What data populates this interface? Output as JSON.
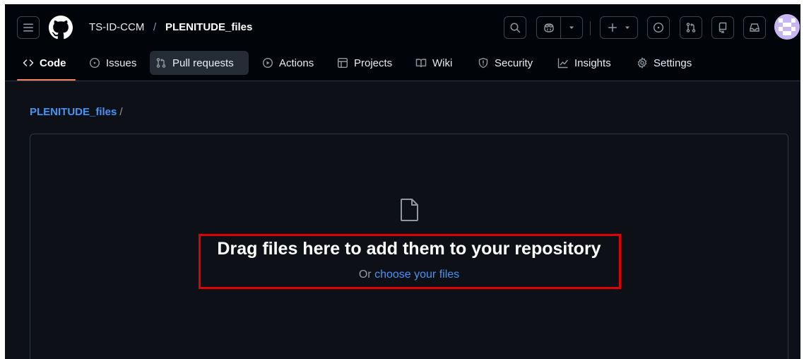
{
  "header": {
    "owner": "TS-ID-CCM",
    "separator": "/",
    "repo_name": "PLENITUDE_files",
    "icons": [
      "menu-icon",
      "github-logo",
      "search-icon",
      "copilot-icon",
      "chevron-down-icon",
      "plus-icon",
      "issue-opened-icon",
      "git-pull-request-icon",
      "repo-icon",
      "inbox-icon",
      "avatar"
    ]
  },
  "tabs": [
    {
      "label": "Code",
      "icon": "code-icon",
      "active": true
    },
    {
      "label": "Issues",
      "icon": "issue-opened-icon"
    },
    {
      "label": "Pull requests",
      "icon": "git-pull-request-icon"
    },
    {
      "label": "Actions",
      "icon": "play-icon"
    },
    {
      "label": "Projects",
      "icon": "table-icon"
    },
    {
      "label": "Wiki",
      "icon": "book-icon"
    },
    {
      "label": "Security",
      "icon": "shield-icon"
    },
    {
      "label": "Insights",
      "icon": "graph-icon"
    },
    {
      "label": "Settings",
      "icon": "gear-icon"
    }
  ],
  "breadcrumb": {
    "repo_link": "PLENITUDE_files",
    "slash": "/"
  },
  "dropzone": {
    "title": "Drag files here to add them to your repository",
    "or_text": "Or",
    "choose_link": "choose your files",
    "icon": "file-icon"
  },
  "colors": {
    "page_bg": "#0d1117",
    "header_bg": "#010409",
    "border": "#30363d",
    "link": "#4493f8",
    "active_tab_underline": "#f78166",
    "highlight_box": "#e00000"
  }
}
